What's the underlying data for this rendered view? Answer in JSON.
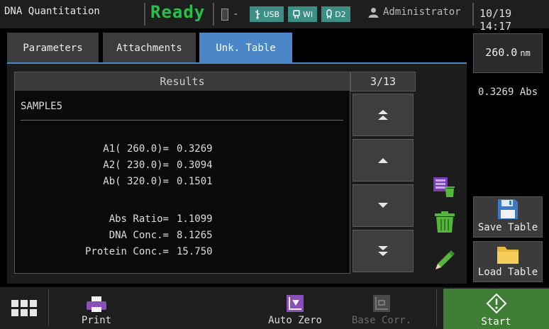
{
  "header": {
    "app_title": "DNA Quantitation",
    "status": "Ready",
    "battery_text": "-",
    "badges": {
      "usb": "USB",
      "wi": "WI",
      "d2": "D2"
    },
    "user": "Administrator",
    "datetime": "10/19 14:17"
  },
  "tabs": [
    {
      "label": "Parameters",
      "active": false
    },
    {
      "label": "Attachments",
      "active": false
    },
    {
      "label": "Unk. Table",
      "active": true
    }
  ],
  "results": {
    "title": "Results",
    "counter": "3/13",
    "sample_name": "SAMPLE5",
    "rows": [
      {
        "label": "A1( 260.0)=",
        "value": "0.3269"
      },
      {
        "label": "A2( 230.0)=",
        "value": "0.3094"
      },
      {
        "label": "Ab( 320.0)=",
        "value": "0.1501"
      },
      {
        "label": "Abs Ratio=",
        "value": "1.1099"
      },
      {
        "label": "DNA Conc.=",
        "value": "8.1265"
      },
      {
        "label": "Protein Conc.=",
        "value": "15.750"
      }
    ]
  },
  "readout": {
    "wavelength": "260.0",
    "wavelength_unit": "nm",
    "absorbance": "0.3269 Abs"
  },
  "side_buttons": {
    "save": "Save Table",
    "load": "Load Table"
  },
  "toolbar": {
    "print": "Print",
    "auto_zero": "Auto Zero",
    "base_corr": "Base Corr.",
    "start": "Start"
  },
  "icons": {
    "menu": "grid-menu-icon",
    "print": "printer-icon",
    "auto_zero": "auto-zero-icon",
    "base_corr": "baseline-correction-icon",
    "start": "start-diamond-icon",
    "save": "floppy-disk-icon",
    "load": "folder-icon",
    "delete_all": "delete-all-icon",
    "delete": "trash-icon",
    "edit": "pencil-icon"
  },
  "colors": {
    "ready": "#28c04a",
    "active_tab": "#4a86c8",
    "badge": "#3c8f84",
    "start": "#3e7d34",
    "accent_purple": "#8a4fb8",
    "trash_green": "#55b53c"
  }
}
